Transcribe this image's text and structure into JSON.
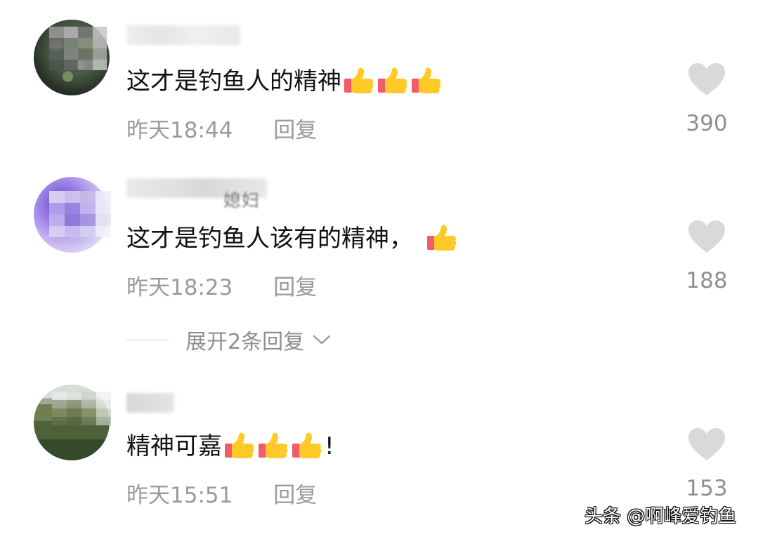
{
  "comments": [
    {
      "name_visible_fragment": "",
      "content": "这才是钓鱼人的精神",
      "emoji_names": [
        "thumbs-up-emoji",
        "thumbs-up-emoji",
        "thumbs-up-emoji"
      ],
      "trailing_text": "",
      "time": "昨天18:44",
      "reply_label": "回复",
      "like_count": "390"
    },
    {
      "name_visible_fragment": "媳妇",
      "content": "这才是钓鱼人该有的精神，",
      "emoji_names": [
        "thumbs-up-emoji"
      ],
      "trailing_text": "",
      "time": "昨天18:23",
      "reply_label": "回复",
      "like_count": "188"
    },
    {
      "name_visible_fragment": "",
      "content": "精神可嘉",
      "emoji_names": [
        "thumbs-up-emoji",
        "thumbs-up-emoji",
        "thumbs-up-emoji"
      ],
      "trailing_text": "!",
      "time": "昨天15:51",
      "reply_label": "回复",
      "like_count": "153"
    }
  ],
  "expand_replies": {
    "label": "展开2条回复",
    "icon": "chevron-down-icon"
  },
  "watermark": "头条 @啊峰爱钓鱼",
  "colors": {
    "text": "#111111",
    "meta": "#9a9a9a",
    "like_icon": "#d8d8d8"
  }
}
